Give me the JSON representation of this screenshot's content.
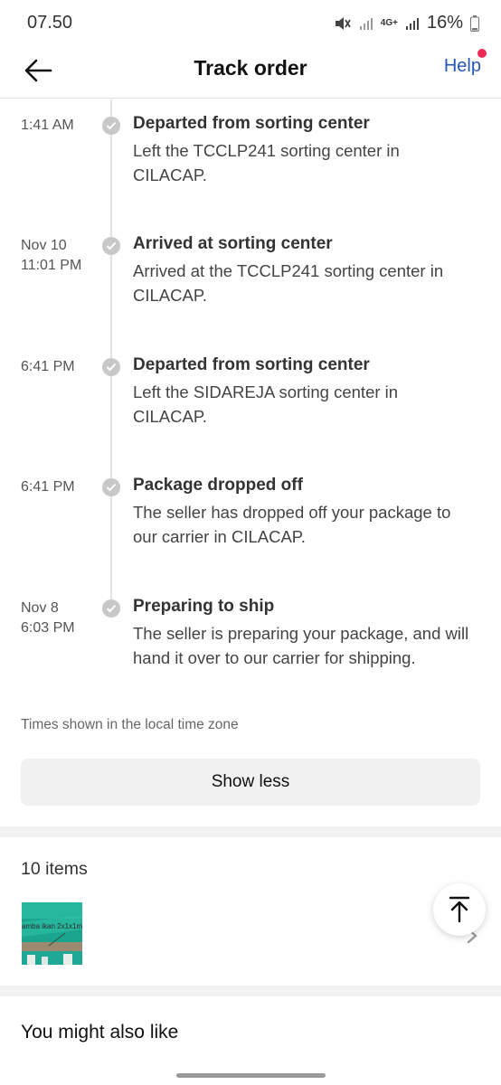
{
  "status_bar": {
    "time": "07.50",
    "network": "4G+",
    "battery": "16%"
  },
  "header": {
    "title": "Track order",
    "help_label": "Help"
  },
  "events": [
    {
      "time": "1:41 AM",
      "title": "Departed from sorting center",
      "desc": "Left the TCCLP241 sorting center in CILACAP."
    },
    {
      "time": "Nov 10\n11:01 PM",
      "title": "Arrived at sorting center",
      "desc": "Arrived at the TCCLP241 sorting center in CILACAP."
    },
    {
      "time": "6:41 PM",
      "title": "Departed from sorting center",
      "desc": "Left the SIDAREJA sorting center in CILACAP."
    },
    {
      "time": "6:41 PM",
      "title": "Package dropped off",
      "desc": "The seller has dropped off your package to our carrier in CILACAP."
    },
    {
      "time": "Nov 8\n6:03 PM",
      "title": "Preparing to ship",
      "desc": "The seller is preparing your package, and will hand it over to our carrier for shipping."
    }
  ],
  "timezone_note": "Times shown in the local time zone",
  "show_less_label": "Show less",
  "items": {
    "title": "10 items",
    "thumb_text": "amba ikan 2x1x1m"
  },
  "recommend": {
    "title": "You might also like"
  },
  "colors": {
    "accent": "#2757b7",
    "dot": "#ee2a55",
    "timeline": "#c8c8c8"
  }
}
